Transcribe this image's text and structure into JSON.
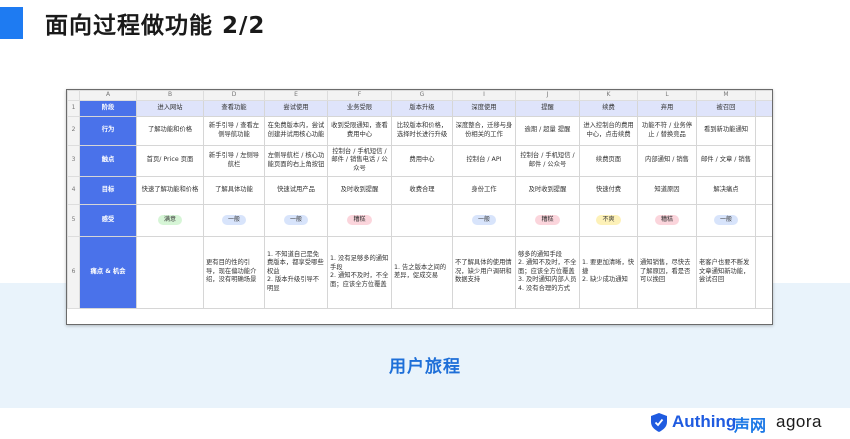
{
  "title": "面向过程做功能 2/2",
  "caption": "用户旅程",
  "brands": {
    "authing": "Authing",
    "shengwang": "声网",
    "agora": "agora"
  },
  "sheet": {
    "col_letters": [
      "A",
      "B",
      "",
      "D",
      "E",
      "F",
      "G",
      "",
      "I",
      "J",
      "K",
      "L",
      "M"
    ],
    "row_numbers": [
      "1",
      "2",
      "3",
      "4",
      "5",
      "6"
    ],
    "stages": [
      "阶段",
      "行为",
      "触点",
      "目标",
      "感受",
      "痛点 & 机会"
    ],
    "headers": [
      "进入网站",
      "查看功能",
      "尝试使用",
      "业务受限",
      "版本升级",
      "深度使用",
      "提醒",
      "续费",
      "弃用",
      "被召回"
    ],
    "rows": {
      "behavior": [
        "了解功能和价格",
        "新手引导 / 查看左侧导航功能",
        "在免费版本内，尝试创建并试用核心功能",
        "收到受限通知，查看费用中心",
        "比较版本和价格，选择时长进行升级",
        "深度整合，迁移与身份相关的工作",
        "逾期 / 超量 提醒",
        "进入控制台的费用中心，点击续费",
        "功能不符 / 业务停止 / 替换竞品",
        "看到新功能通知"
      ],
      "touchpoint": [
        "首页/ Price 页面",
        "新手引导 / 左侧导航栏",
        "左侧导航栏 / 核心功能页面的右上角按钮",
        "控制台 / 手机短信 / 邮件 / 销售电话 / 公众号",
        "费用中心",
        "控制台 / API",
        "控制台 / 手机短信 / 邮件 / 公众号",
        "续费页面",
        "内部通知 / 销售",
        "邮件 / 文章 / 销售"
      ],
      "goal": [
        "快速了解功能和价格",
        "了解具体功能",
        "快速试用产品",
        "及时收到提醒",
        "收费合理",
        "身份工作",
        "及时收到提醒",
        "快速付费",
        "知道原因",
        "解决痛点"
      ],
      "feeling": [
        "满意",
        "一般",
        "一般",
        "糟糕",
        "",
        "一般",
        "糟糕",
        "不爽",
        "糟糕",
        "一般"
      ],
      "pain": [
        "",
        "更有目的性的引导，现在偏功能介绍，没有明确场景",
        "1. 不知道自己是免费版本，都享受哪些权益\n2. 版本升级引导不明显",
        "1. 没有足够多的通知手段\n2. 通知不及时，不全面；应该全方位覆盖",
        "1. 告之版本之间的差异，促成交易",
        "不了解具体的使用情况，缺少用户调研和数据支持",
        "够多的通知手段\n2. 通知不及时，不全面；应该全方位覆盖\n3. 及时通知内部人员\n4. 没有合理的方式",
        "1. 要更加清晰，快捷\n2. 缺少成功通知",
        "通知销售，尽快去了解原因，看是否可以挽回",
        "老客户也要不断发文章通知新功能，尝试召回"
      ]
    }
  },
  "colors": {
    "accent": "#1e7bf2",
    "stage_bg": "#4a72ea",
    "header_bg": "#dfe4fb",
    "chip_satisfied": "#d6f5d6",
    "chip_normal": "#d8e4fb",
    "chip_bad": "#fbd5dc",
    "chip_unhappy": "#fdf1b8"
  }
}
